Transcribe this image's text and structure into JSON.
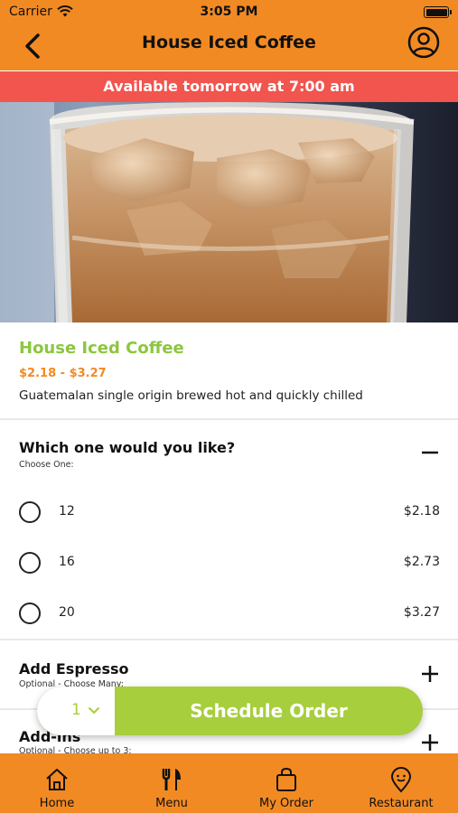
{
  "status_bar": {
    "carrier": "Carrier",
    "time": "3:05 PM"
  },
  "nav": {
    "title": "House Iced Coffee",
    "back_icon": "chevron-left-icon",
    "profile_icon": "user-circle-icon"
  },
  "banner": {
    "text": "Available tomorrow at 7:00 am",
    "color": "#f2544e"
  },
  "product": {
    "name": "House Iced Coffee",
    "price_range": "$2.18 - $3.27",
    "description": "Guatemalan single origin brewed hot and quickly chilled"
  },
  "size_group": {
    "title": "Which one would you like?",
    "subtitle": "Choose One:",
    "toggle_icon": "minus-icon",
    "options": [
      {
        "label": "12",
        "price": "$2.18"
      },
      {
        "label": "16",
        "price": "$2.73"
      },
      {
        "label": "20",
        "price": "$3.27"
      }
    ]
  },
  "espresso_group": {
    "title": "Add Espresso",
    "subtitle": "Optional - Choose Many:",
    "toggle_icon": "plus-icon"
  },
  "addins_group": {
    "title": "Add-ins",
    "subtitle": "Optional - Choose up to 3:",
    "toggle_icon": "plus-icon"
  },
  "order": {
    "quantity": "1",
    "button_label": "Schedule Order",
    "button_color": "#a7ce3d"
  },
  "tabs": [
    {
      "label": "Home",
      "icon": "home-icon"
    },
    {
      "label": "Menu",
      "icon": "fork-knife-icon"
    },
    {
      "label": "My Order",
      "icon": "shopping-bag-icon"
    },
    {
      "label": "Restaurant",
      "icon": "location-pin-icon"
    }
  ],
  "colors": {
    "brand_orange": "#f28a23",
    "product_green": "#8cc63f"
  }
}
